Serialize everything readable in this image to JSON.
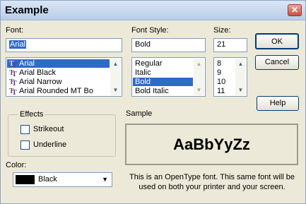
{
  "window": {
    "title": "Example",
    "close_glyph": "✕"
  },
  "font": {
    "label": "Font:",
    "value": "Arial",
    "items": [
      "Arial",
      "Arial Black",
      "Arial Narrow",
      "Arial Rounded MT Bo"
    ],
    "selected_index": 0
  },
  "font_style": {
    "label": "Font Style:",
    "value": "Bold",
    "items": [
      "Regular",
      "Italic",
      "Bold",
      "Bold Italic"
    ],
    "selected_index": 2
  },
  "size": {
    "label": "Size:",
    "value": "21",
    "items": [
      "8",
      "9",
      "10",
      "11"
    ]
  },
  "buttons": {
    "ok": "OK",
    "cancel": "Cancel",
    "help": "Help"
  },
  "effects": {
    "label": "Effects",
    "strikeout": "Strikeout",
    "underline": "Underline"
  },
  "color": {
    "label": "Color:",
    "value": "Black",
    "swatch": "#000000"
  },
  "sample": {
    "label": "Sample",
    "text": "AaBbYyZz"
  },
  "description": {
    "line1": "This is an OpenType font. This same font will be",
    "line2": "used on both your printer and your screen."
  },
  "colors": {
    "selection": "#316ac5",
    "dialog_bg": "#ece9d8"
  }
}
